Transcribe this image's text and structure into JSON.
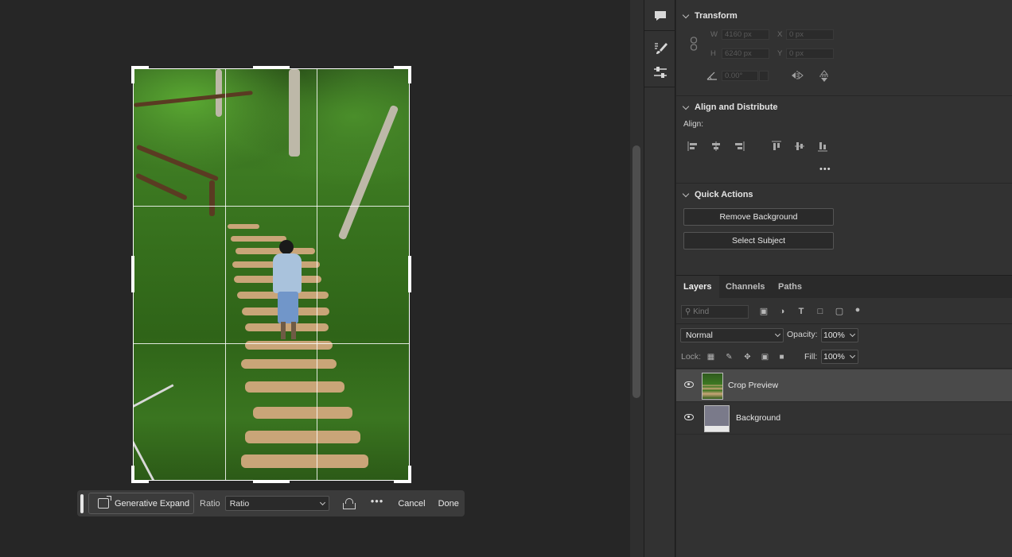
{
  "crop_toolbar": {
    "generative_expand_label": "Generative Expand",
    "ratio_label": "Ratio",
    "ratio_value": "Ratio",
    "more_label": "•••",
    "cancel_label": "Cancel",
    "done_label": "Done"
  },
  "properties": {
    "transform": {
      "title": "Transform",
      "w_label": "W",
      "w_value": "4160 px",
      "x_label": "X",
      "x_value": "0 px",
      "h_label": "H",
      "h_value": "6240 px",
      "y_label": "Y",
      "y_value": "0 px",
      "angle_value": "0.00°"
    },
    "align": {
      "title": "Align and Distribute",
      "align_label": "Align:",
      "more_label": "•••"
    },
    "quick_actions": {
      "title": "Quick Actions",
      "remove_bg_label": "Remove Background",
      "select_subject_label": "Select Subject"
    }
  },
  "layers_panel": {
    "tabs": [
      "Layers",
      "Channels",
      "Paths"
    ],
    "kind_placeholder": "Kind",
    "blend_mode": "Normal",
    "opacity_label": "Opacity:",
    "opacity_value": "100%",
    "lock_label": "Lock:",
    "fill_label": "Fill:",
    "fill_value": "100%",
    "layers": [
      {
        "name": "Crop Preview",
        "selected": true
      },
      {
        "name": "Background",
        "selected": false
      }
    ]
  },
  "colors": {
    "canvas_bg": "#262626",
    "panel_bg": "#323232",
    "selected_layer": "#4a4a4a"
  }
}
